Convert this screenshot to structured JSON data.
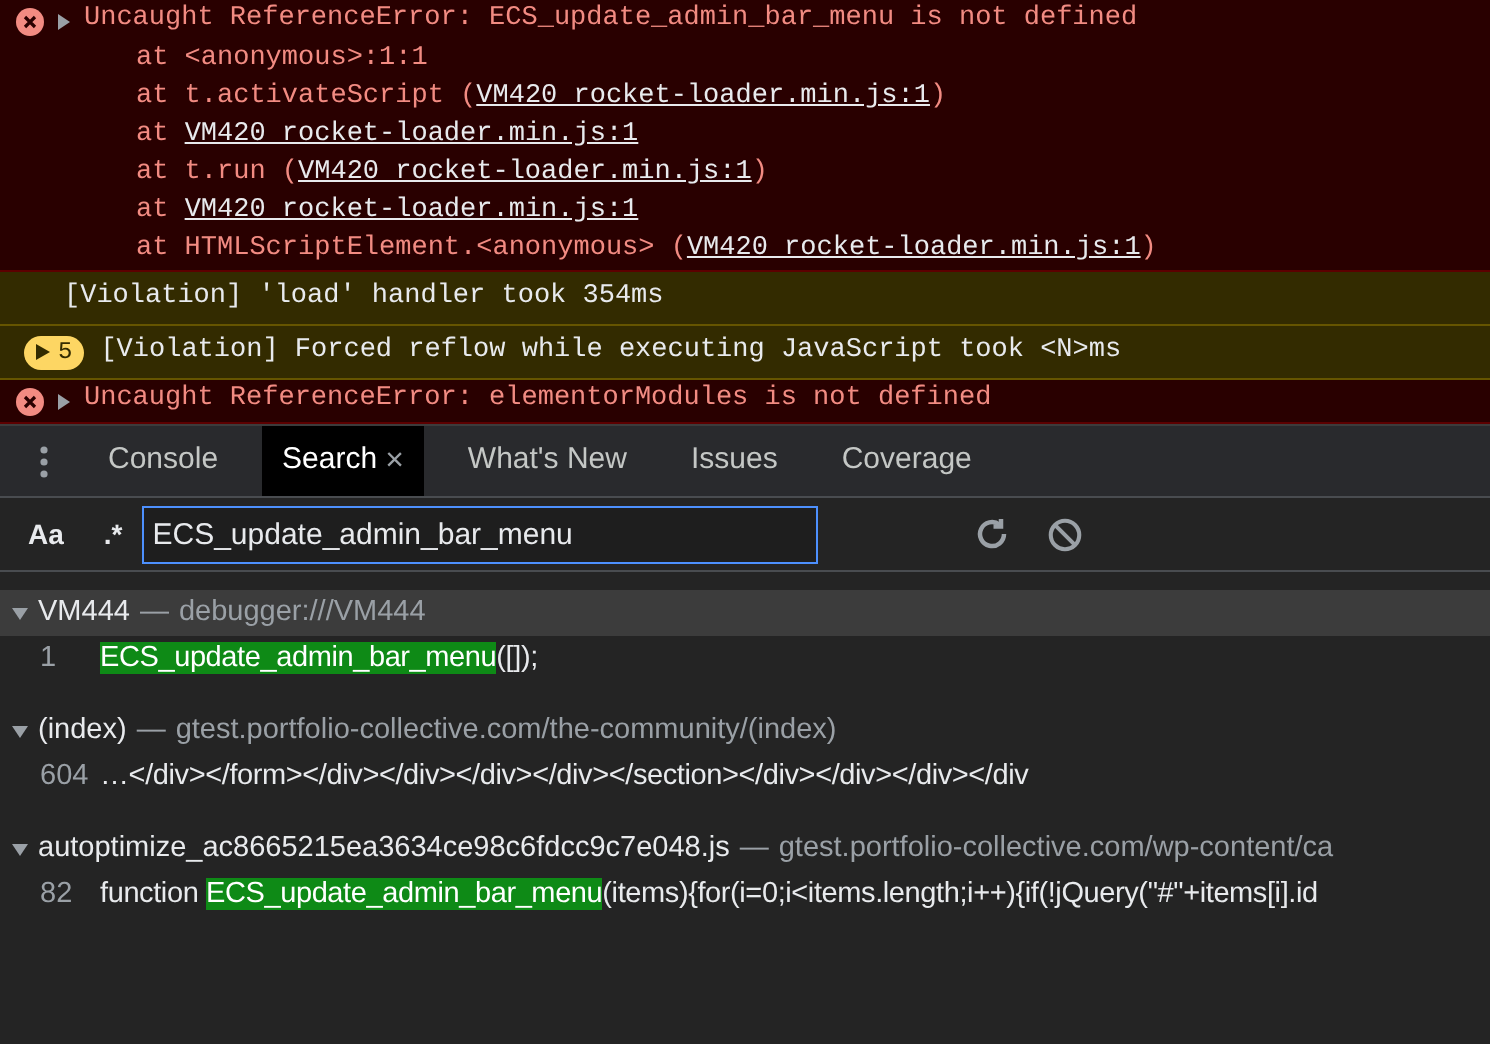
{
  "console": {
    "messages": [
      {
        "kind": "error",
        "expanded": false,
        "text": "Uncaught ReferenceError: ECS_update_admin_bar_menu is not defined",
        "stack": [
          {
            "before": "at <anonymous>:1:1"
          },
          {
            "before": "at t.activateScript (",
            "link": "VM420 rocket-loader.min.js:1",
            "after": ")"
          },
          {
            "before": "at ",
            "link": "VM420 rocket-loader.min.js:1"
          },
          {
            "before": "at t.run (",
            "link": "VM420 rocket-loader.min.js:1",
            "after": ")"
          },
          {
            "before": "at ",
            "link": "VM420 rocket-loader.min.js:1"
          },
          {
            "before": "at HTMLScriptElement.<anonymous> (",
            "link": "VM420 rocket-loader.min.js:1",
            "after": ")"
          }
        ]
      },
      {
        "kind": "violation",
        "text": "[Violation] 'load' handler took 354ms"
      },
      {
        "kind": "violation",
        "count": "5",
        "text": "[Violation] Forced reflow while executing JavaScript took <N>ms"
      },
      {
        "kind": "error",
        "expanded": false,
        "text": "Uncaught ReferenceError: elementorModules is not defined"
      }
    ]
  },
  "tabs": [
    {
      "label": "Console",
      "selected": false,
      "closable": false
    },
    {
      "label": "Search",
      "selected": true,
      "closable": true,
      "close": "×"
    },
    {
      "label": "What's New",
      "selected": false,
      "closable": false
    },
    {
      "label": "Issues",
      "selected": false,
      "closable": false
    },
    {
      "label": "Coverage",
      "selected": false,
      "closable": false
    }
  ],
  "search": {
    "case_toggle": "Aa",
    "regex_toggle": ".*",
    "value": "ECS_update_admin_bar_menu"
  },
  "results": [
    {
      "file": "VM444",
      "separator": "—",
      "path": "debugger:///VM444",
      "expanded": true,
      "selected": true,
      "lines": [
        {
          "line": "1",
          "segments": [
            {
              "text": "ECS_update_admin_bar_menu",
              "match": true
            },
            {
              "text": "([]);",
              "match": false
            }
          ]
        }
      ]
    },
    {
      "file": "(index)",
      "separator": "—",
      "path": "gtest.portfolio-collective.com/the-community/(index)",
      "expanded": true,
      "selected": false,
      "lines": [
        {
          "line": "604",
          "segments": [
            {
              "text": "…</div></form></div></div></div></div></section></div></div></div></div",
              "match": false
            }
          ]
        }
      ]
    },
    {
      "file": "autoptimize_ac8665215ea3634ce98c6fdcc9c7e048.js",
      "separator": "—",
      "path": "gtest.portfolio-collective.com/wp-content/ca",
      "expanded": true,
      "selected": false,
      "lines": [
        {
          "line": "82",
          "segments": [
            {
              "text": "function ",
              "match": false
            },
            {
              "text": "ECS_update_admin_bar_menu",
              "match": true
            },
            {
              "text": "(items){for(i=0;i<items.length;i++){if(!jQuery(\"#\"+items[i].id",
              "match": false
            }
          ]
        }
      ]
    }
  ]
}
